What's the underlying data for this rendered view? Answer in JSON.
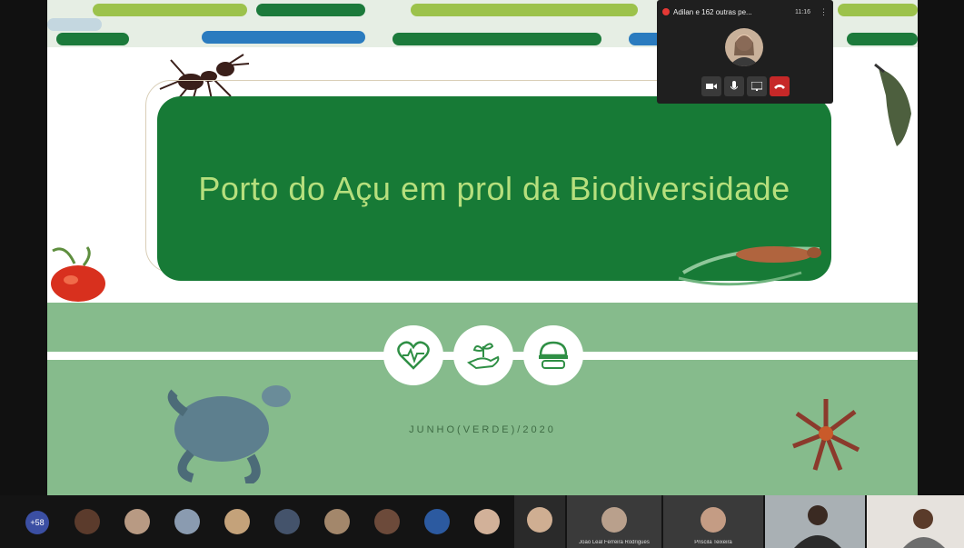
{
  "slide": {
    "title": "Porto do Açu em prol da Biodiversidade",
    "footer": "JUNHO(VERDE)/2020"
  },
  "meeting": {
    "title": "Adilan e 162 outras pe...",
    "time": "11:16",
    "menu": "⋮"
  },
  "participants": {
    "more_count": "+58",
    "tiles": [
      {
        "name": "João Leal Ferreira Rodrigues"
      },
      {
        "name": "Priscila Teixeira"
      }
    ]
  },
  "colors": {
    "title_box": "#177a36",
    "title_text": "#b6df7d",
    "lower_band": "#86bb8c",
    "end_call": "#c62828"
  },
  "icons": [
    "heart-rate-icon",
    "hand-plant-icon",
    "safety-helmet-icon",
    "camera-icon",
    "mic-icon",
    "present-icon",
    "end-call-icon"
  ]
}
